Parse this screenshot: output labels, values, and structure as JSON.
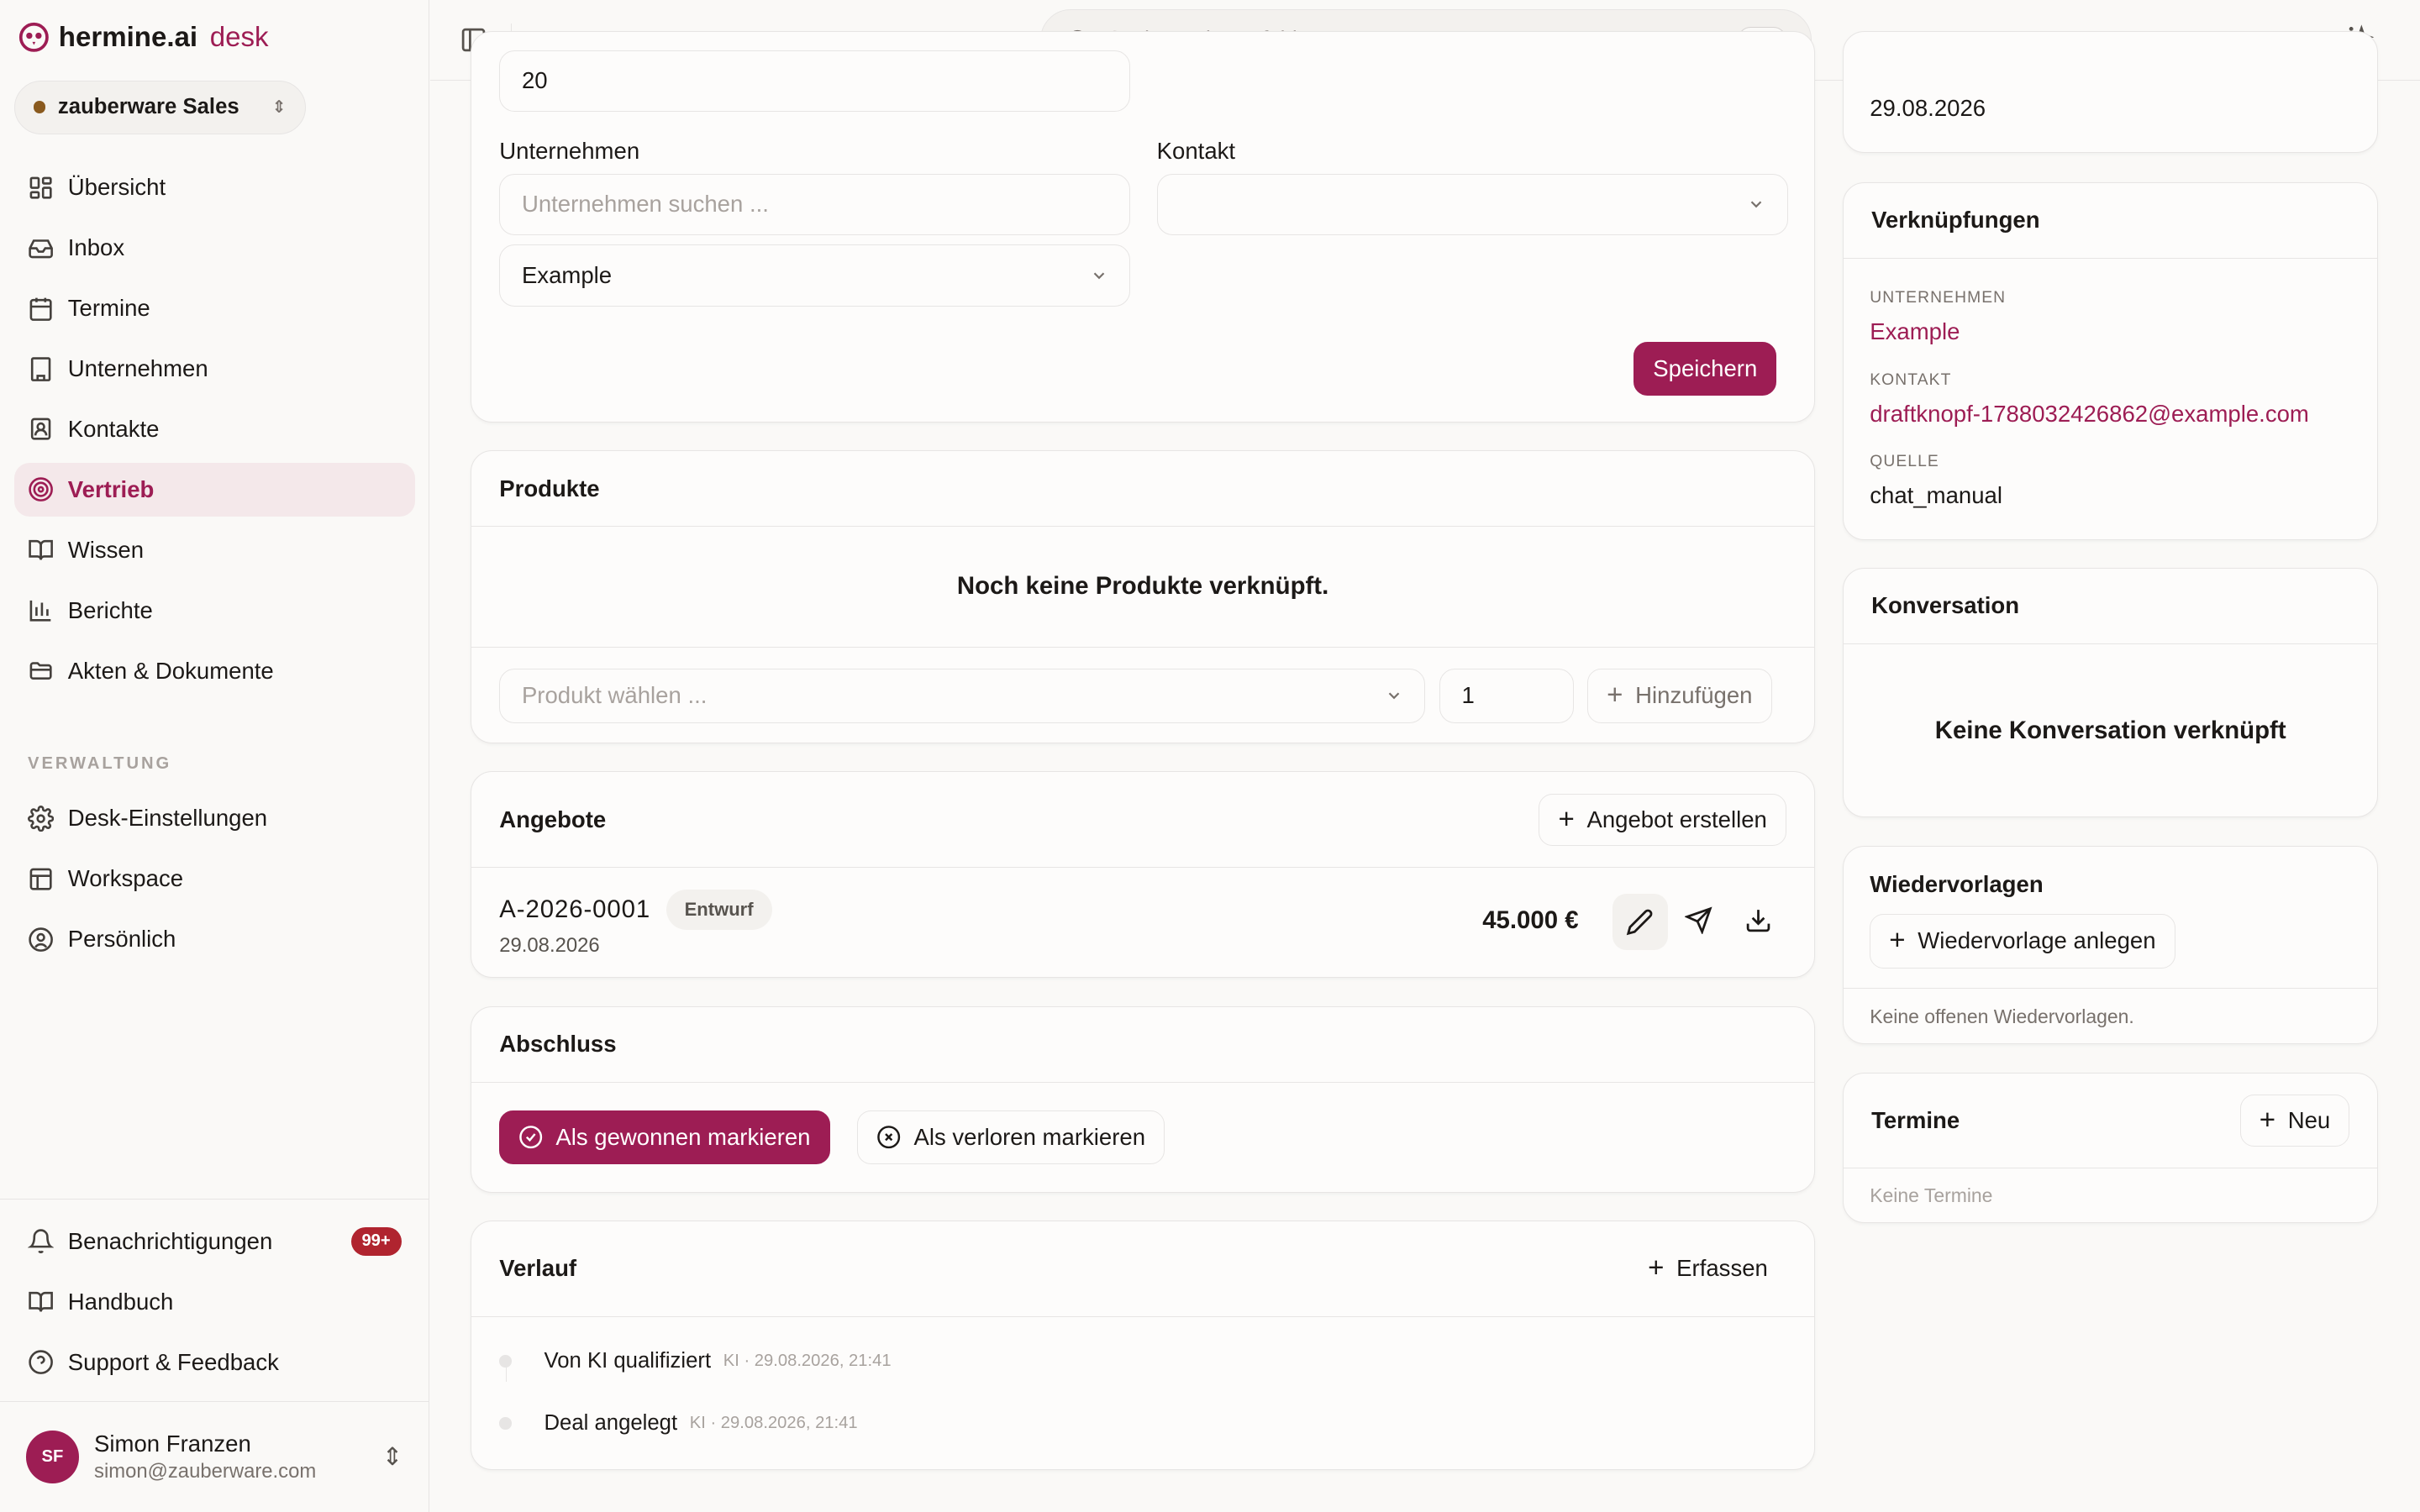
{
  "brand": {
    "name": "hermine.ai",
    "product": "desk"
  },
  "workspace": {
    "name": "zauberware Sales"
  },
  "nav": {
    "items": [
      {
        "label": "Übersicht",
        "icon": "dashboard-icon"
      },
      {
        "label": "Inbox",
        "icon": "inbox-icon"
      },
      {
        "label": "Termine",
        "icon": "calendar-icon"
      },
      {
        "label": "Unternehmen",
        "icon": "building-icon"
      },
      {
        "label": "Kontakte",
        "icon": "contact-icon"
      },
      {
        "label": "Vertrieb",
        "icon": "target-icon",
        "active": true
      },
      {
        "label": "Wissen",
        "icon": "book-icon"
      },
      {
        "label": "Berichte",
        "icon": "chart-icon"
      },
      {
        "label": "Akten & Dokumente",
        "icon": "folder-icon"
      }
    ],
    "admin_section_label": "VERWALTUNG",
    "admin_items": [
      {
        "label": "Desk-Einstellungen",
        "icon": "gear-icon"
      },
      {
        "label": "Workspace",
        "icon": "layout-icon"
      },
      {
        "label": "Persönlich",
        "icon": "user-circle-icon"
      }
    ],
    "footer_items": [
      {
        "label": "Benachrichtigungen",
        "icon": "bell-icon",
        "badge": "99+"
      },
      {
        "label": "Handbuch",
        "icon": "book-icon"
      },
      {
        "label": "Support & Feedback",
        "icon": "help-icon"
      }
    ]
  },
  "user": {
    "initials": "SF",
    "name": "Simon Franzen",
    "email": "simon@zauberware.com"
  },
  "search": {
    "placeholder": "Suchen oder Befehl ...",
    "shortcut": "⌘K"
  },
  "form": {
    "partial_value": "20",
    "company_label": "Unternehmen",
    "company_placeholder": "Unternehmen suchen ...",
    "company_selected": "Example",
    "contact_label": "Kontakt",
    "contact_selected": "",
    "save_label": "Speichern"
  },
  "products": {
    "title": "Produkte",
    "empty_text": "Noch keine Produkte verknüpft.",
    "select_placeholder": "Produkt wählen ...",
    "quantity": "1",
    "add_label": "Hinzufügen"
  },
  "offers": {
    "title": "Angebote",
    "create_label": "Angebot erstellen",
    "items": [
      {
        "number": "A-2026-0001",
        "status": "Entwurf",
        "date": "29.08.2026",
        "amount": "45.000 €"
      }
    ]
  },
  "closing": {
    "title": "Abschluss",
    "won_label": "Als gewonnen markieren",
    "lost_label": "Als verloren markieren"
  },
  "history": {
    "title": "Verlauf",
    "capture_label": "Erfassen",
    "entries": [
      {
        "text": "Von KI qualifiziert",
        "meta": "KI · 29.08.2026, 21:41"
      },
      {
        "text": "Deal angelegt",
        "meta": "KI · 29.08.2026, 21:41"
      }
    ]
  },
  "right": {
    "date_value": "29.08.2026",
    "links": {
      "title": "Verknüpfungen",
      "company_label": "UNTERNEHMEN",
      "company_value": "Example",
      "contact_label": "KONTAKT",
      "contact_value": "draftknopf-1788032426862@example.com",
      "source_label": "QUELLE",
      "source_value": "chat_manual"
    },
    "conversation": {
      "title": "Konversation",
      "empty_text": "Keine Konversation verknüpft"
    },
    "followups": {
      "title": "Wiedervorlagen",
      "create_label": "Wiedervorlage anlegen",
      "empty_text": "Keine offenen Wiedervorlagen."
    },
    "appointments": {
      "title": "Termine",
      "new_label": "Neu",
      "empty_text": "Keine Termine"
    }
  },
  "colors": {
    "accent": "#9d1d54",
    "badge": "#b0242f",
    "active_bg": "#f4e8ea"
  }
}
